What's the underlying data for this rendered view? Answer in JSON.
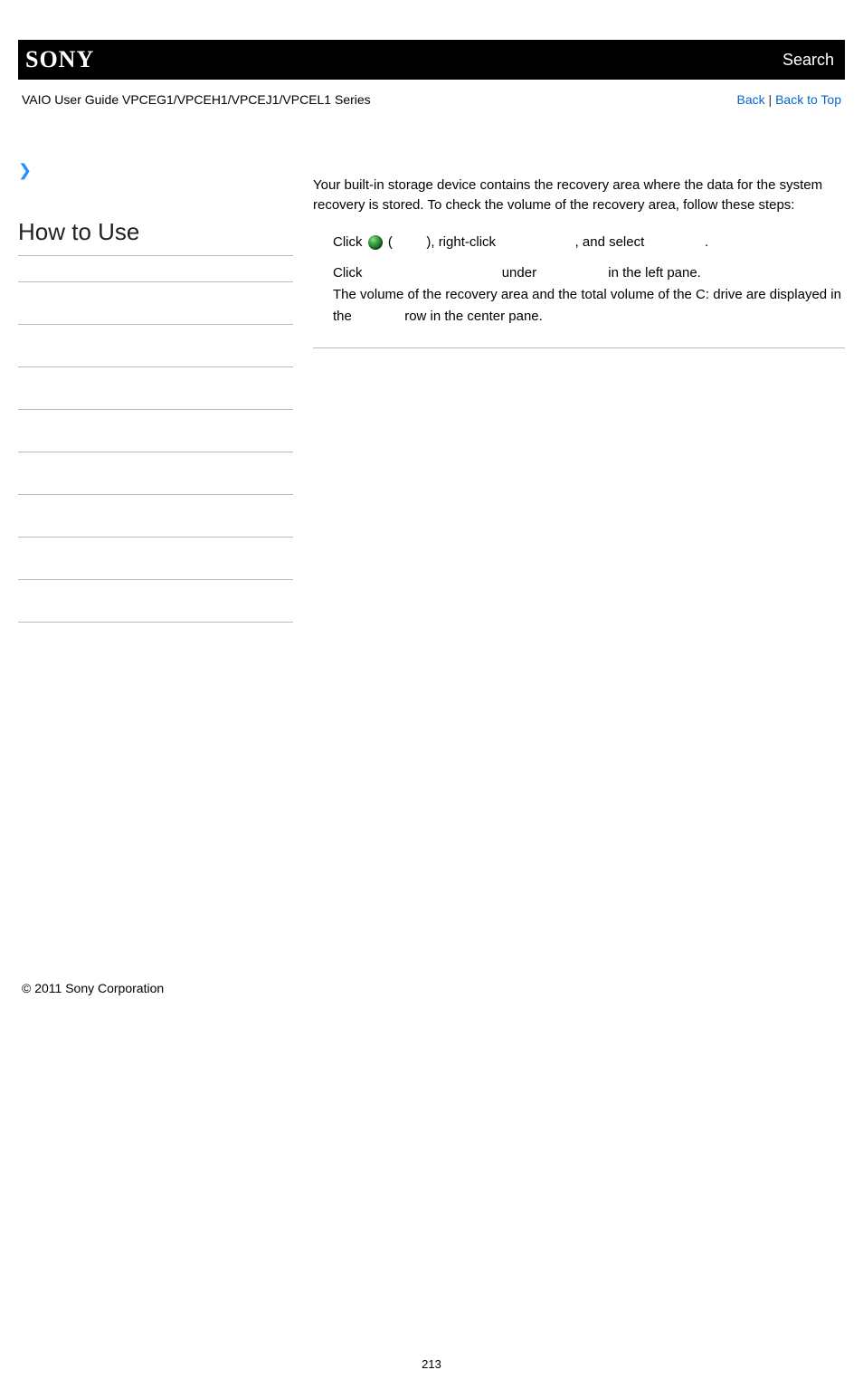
{
  "header": {
    "logo": "SONY",
    "search": "Search"
  },
  "subheader": {
    "title": "VAIO User Guide VPCEG1/VPCEH1/VPCEJ1/VPCEL1 Series",
    "back": "Back",
    "separator": " | ",
    "backToTop": "Back to Top"
  },
  "sidebar": {
    "heading": "How to Use"
  },
  "article": {
    "intro": "Your built-in storage device contains the recovery area where the data for the system recovery is stored. To check the volume of the recovery area, follow these steps:",
    "step1": {
      "a": "Click ",
      "b": " (",
      "c": "), right-click ",
      "d": ", and select ",
      "e": "."
    },
    "step2": {
      "a": "Click ",
      "b": " under ",
      "c": " in the left pane.",
      "line2a": "The volume of the recovery area and the total volume of the C: drive are displayed in the ",
      "line2b": " row in the center pane."
    }
  },
  "footer": {
    "copyright": "© 2011 Sony Corporation"
  },
  "pageNumber": "213"
}
